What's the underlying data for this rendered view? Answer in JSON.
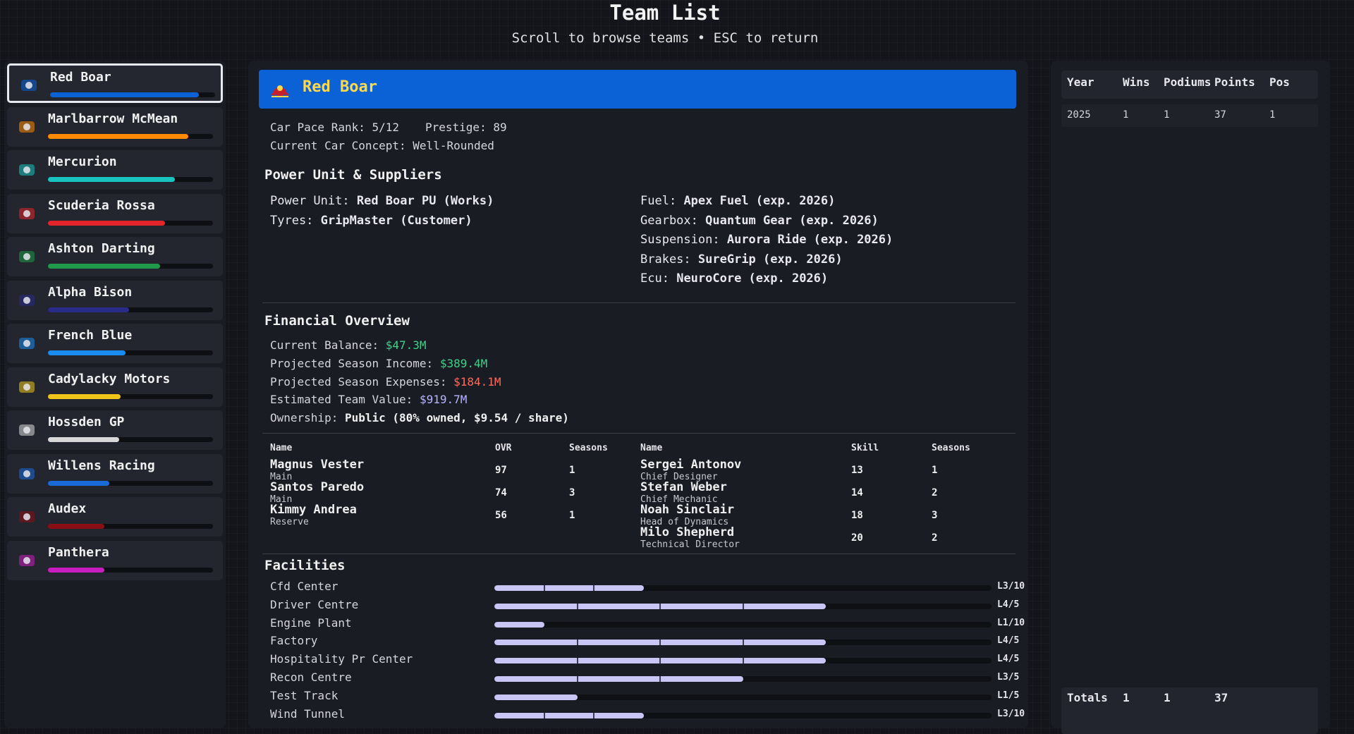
{
  "header": {
    "title": "Team List",
    "subtitle": "Scroll to browse teams • ESC to return"
  },
  "teams": [
    {
      "name": "Red Boar",
      "bar": 0.9,
      "color": "#0b62d6",
      "icon": "boar-logo-icon",
      "selected": true
    },
    {
      "name": "Marlbarrow McMean",
      "bar": 0.85,
      "color": "#ff8a00",
      "icon": "marlbarrow-logo-icon"
    },
    {
      "name": "Mercurion",
      "bar": 0.77,
      "color": "#19c4c0",
      "icon": "star-logo-icon"
    },
    {
      "name": "Scuderia Rossa",
      "bar": 0.71,
      "color": "#e3242b",
      "icon": "horse-shield-icon"
    },
    {
      "name": "Ashton Darting",
      "bar": 0.68,
      "color": "#1e9a4a",
      "icon": "wings-logo-icon"
    },
    {
      "name": "Alpha Bison",
      "bar": 0.49,
      "color": "#2a2a8a",
      "icon": "bison-logo-icon"
    },
    {
      "name": "French Blue",
      "bar": 0.47,
      "color": "#1a8cf0",
      "icon": "flag-logo-icon"
    },
    {
      "name": "Cadylacky Motors",
      "bar": 0.44,
      "color": "#f0c419",
      "icon": "cadylacky-logo-icon"
    },
    {
      "name": "Hossden GP",
      "bar": 0.43,
      "color": "#d8d8d8",
      "icon": "castle-logo-icon"
    },
    {
      "name": "Willens Racing",
      "bar": 0.37,
      "color": "#1a6ad8",
      "icon": "globe-logo-icon"
    },
    {
      "name": "Audex",
      "bar": 0.34,
      "color": "#8a0f14",
      "icon": "rings-logo-icon"
    },
    {
      "name": "Panthera",
      "bar": 0.34,
      "color": "#c81ec0",
      "icon": "panther-logo-icon"
    }
  ],
  "detail": {
    "team_name": "Red Boar",
    "pace_rank_line": "Car Pace Rank: 5/12",
    "prestige_line": "Prestige: 89",
    "concept_line": "Current Car Concept: Well-Rounded",
    "supplier_title": "Power Unit & Suppliers",
    "suppliers_left": [
      {
        "label": "Power Unit:",
        "value": "Red Boar PU (Works)"
      },
      {
        "label": "Tyres:",
        "value": "GripMaster (Customer)"
      }
    ],
    "suppliers_right": [
      {
        "label": "Fuel:",
        "value": "Apex Fuel (exp. 2026)"
      },
      {
        "label": "Gearbox:",
        "value": "Quantum Gear (exp. 2026)"
      },
      {
        "label": "Suspension:",
        "value": "Aurora Ride (exp. 2026)"
      },
      {
        "label": "Brakes:",
        "value": "SureGrip (exp. 2026)"
      },
      {
        "label": "Ecu:",
        "value": "NeuroCore (exp. 2026)"
      }
    ],
    "financial_title": "Financial Overview",
    "financial": [
      {
        "label": "Current Balance:",
        "value": "$47.3M",
        "tone": "green"
      },
      {
        "label": "Projected Season Income:",
        "value": "$389.4M",
        "tone": "green"
      },
      {
        "label": "Projected Season Expenses:",
        "value": "$184.1M",
        "tone": "red"
      },
      {
        "label": "Estimated Team Value:",
        "value": "$919.7M",
        "tone": "violet"
      },
      {
        "label": "Ownership:",
        "value": "Public (80% owned, $9.54 / share)",
        "tone": "bold"
      }
    ],
    "drivers_headers": {
      "name": "Name",
      "ovr": "OVR",
      "seasons": "Seasons"
    },
    "drivers": [
      {
        "name": "Magnus Vester",
        "role": "Main",
        "ovr": "97",
        "seasons": "1"
      },
      {
        "name": "Santos Paredo",
        "role": "Main",
        "ovr": "74",
        "seasons": "3"
      },
      {
        "name": "Kimmy Andrea",
        "role": "Reserve",
        "ovr": "56",
        "seasons": "1"
      }
    ],
    "staff_headers": {
      "name": "Name",
      "skill": "Skill",
      "seasons": "Seasons"
    },
    "staff": [
      {
        "name": "Sergei Antonov",
        "role": "Chief Designer",
        "skill": "13",
        "seasons": "1"
      },
      {
        "name": "Stefan Weber",
        "role": "Chief Mechanic",
        "skill": "14",
        "seasons": "2"
      },
      {
        "name": "Noah Sinclair",
        "role": "Head of Dynamics",
        "skill": "18",
        "seasons": "3"
      },
      {
        "name": "Milo Shepherd",
        "role": "Technical Director",
        "skill": "20",
        "seasons": "2"
      }
    ],
    "facilities_title": "Facilities",
    "facilities": [
      {
        "name": "Cfd Center",
        "level": 3,
        "max": 10,
        "label": "L3/10"
      },
      {
        "name": "Driver Centre",
        "level": 4,
        "max": 5,
        "label": "L4/5"
      },
      {
        "name": "Engine Plant",
        "level": 1,
        "max": 10,
        "label": "L1/10"
      },
      {
        "name": "Factory",
        "level": 4,
        "max": 5,
        "label": "L4/5"
      },
      {
        "name": "Hospitality Pr Center",
        "level": 4,
        "max": 5,
        "label": "L4/5"
      },
      {
        "name": "Recon Centre",
        "level": 3,
        "max": 5,
        "label": "L3/5"
      },
      {
        "name": "Test Track",
        "level": 1,
        "max": 5,
        "label": "L1/5"
      },
      {
        "name": "Wind Tunnel",
        "level": 3,
        "max": 10,
        "label": "L3/10"
      }
    ]
  },
  "history": {
    "headers": [
      "Year",
      "Wins",
      "Podiums",
      "Points",
      "Pos"
    ],
    "rows": [
      [
        "2025",
        "1",
        "1",
        "37",
        "1"
      ]
    ],
    "totals": {
      "label": "Totals",
      "wins": "1",
      "podiums": "1",
      "points": "37"
    }
  }
}
